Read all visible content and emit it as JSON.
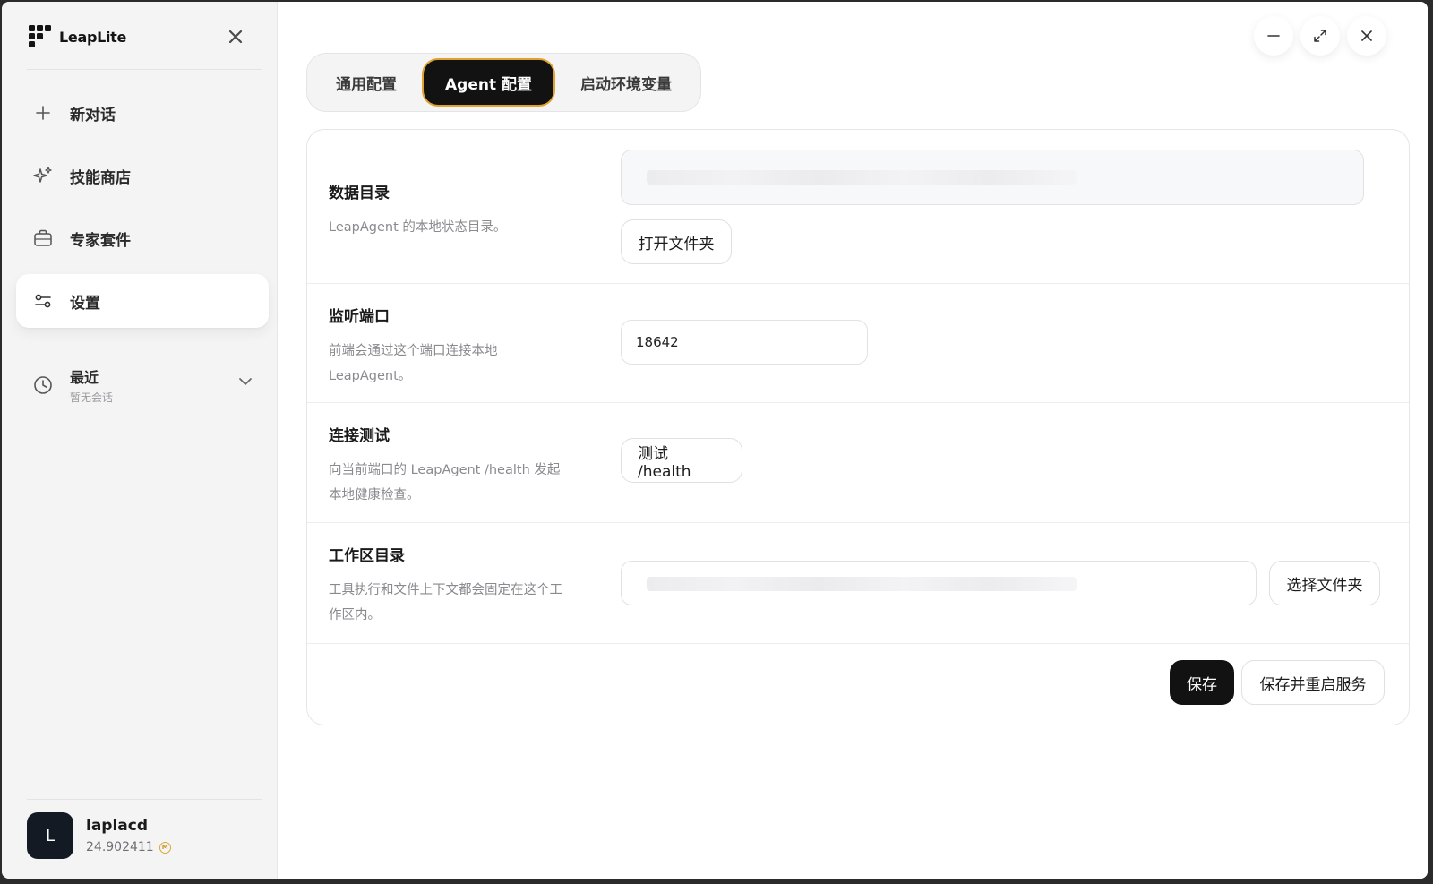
{
  "app": {
    "name": "LeapLite"
  },
  "sidebar": {
    "items": [
      {
        "label": "新对话",
        "icon": "plus-icon"
      },
      {
        "label": "技能商店",
        "icon": "sparkle-icon"
      },
      {
        "label": "专家套件",
        "icon": "briefcase-icon"
      },
      {
        "label": "设置",
        "icon": "sliders-icon",
        "active": true
      }
    ],
    "recent": {
      "title": "最近",
      "subtitle": "暂无会话"
    },
    "user": {
      "initial": "L",
      "name": "laplacd",
      "balance": "24.902411",
      "coin_symbol": "M"
    }
  },
  "tabs": [
    {
      "label": "通用配置"
    },
    {
      "label": "Agent 配置",
      "active": true
    },
    {
      "label": "启动环境变量"
    }
  ],
  "settings": {
    "data_dir": {
      "title": "数据目录",
      "desc": "LeapAgent 的本地状态目录。",
      "value": "",
      "open_button": "打开文件夹"
    },
    "port": {
      "title": "监听端口",
      "desc_line1": "前端会通过这个端口连接本地",
      "desc_line2": "LeapAgent。",
      "value": "18642"
    },
    "test": {
      "title": "连接测试",
      "desc_line1": "向当前端口的 LeapAgent /health 发起",
      "desc_line2": "本地健康检查。",
      "button": "测试 /health"
    },
    "workspace": {
      "title": "工作区目录",
      "desc_line1": "工具执行和文件上下文都会固定在这个工",
      "desc_line2": "作区内。",
      "value": "",
      "select_button": "选择文件夹"
    }
  },
  "actions": {
    "save": "保存",
    "save_restart": "保存并重启服务"
  },
  "colors": {
    "accent": "#e0a12e",
    "primary": "#121212",
    "sidebar_bg": "#f4f4f5"
  }
}
